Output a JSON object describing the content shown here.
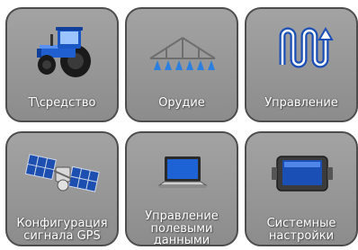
{
  "menu": {
    "tiles": [
      {
        "label": "Т\\средство",
        "icon": "tractor-icon"
      },
      {
        "label": "Орудие",
        "icon": "sprayer-boom-icon"
      },
      {
        "label": "Управление",
        "icon": "steering-path-icon"
      },
      {
        "label": "Конфигурация\nсигнала GPS",
        "icon": "gps-satellite-icon"
      },
      {
        "label": "Управление\nполевыми\nданными",
        "icon": "laptop-icon"
      },
      {
        "label": "Системные\nнастройки",
        "icon": "display-terminal-icon"
      }
    ]
  },
  "colors": {
    "tile_bg": "#9a9a9a",
    "tile_border": "#4d4d4d",
    "label_text": "#ffffff",
    "accent_blue": "#1e63d6"
  }
}
